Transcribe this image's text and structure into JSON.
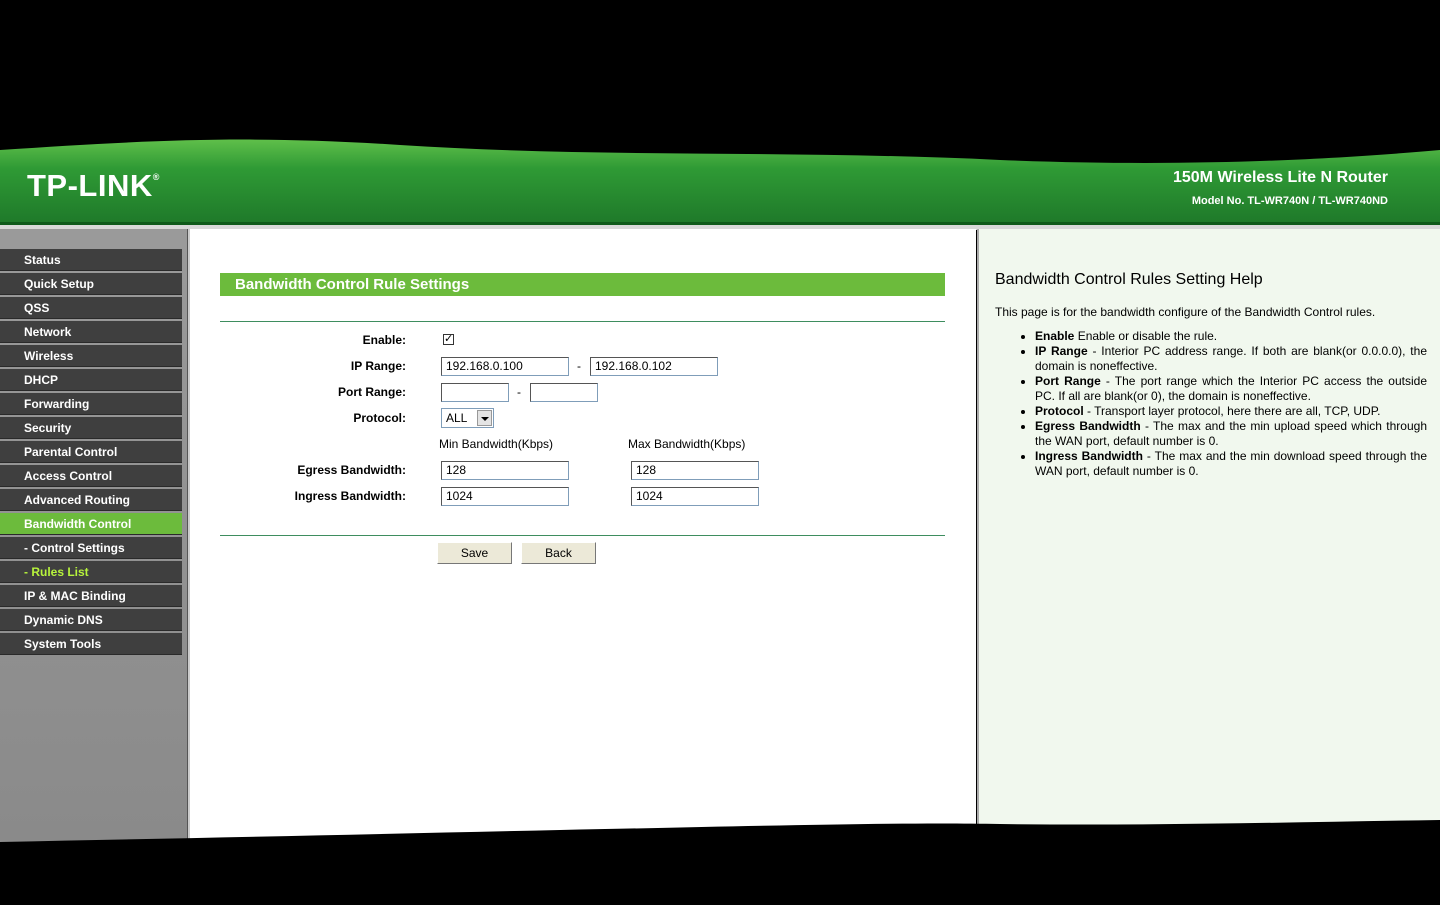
{
  "brand": {
    "logo": "TP-LINK",
    "reg_mark": "®"
  },
  "product": {
    "name": "150M Wireless Lite N Router",
    "model": "Model No. TL-WR740N / TL-WR740ND"
  },
  "sidebar": {
    "items": [
      {
        "label": "Status"
      },
      {
        "label": "Quick Setup"
      },
      {
        "label": "QSS"
      },
      {
        "label": "Network"
      },
      {
        "label": "Wireless"
      },
      {
        "label": "DHCP"
      },
      {
        "label": "Forwarding"
      },
      {
        "label": "Security"
      },
      {
        "label": "Parental Control"
      },
      {
        "label": "Access Control"
      },
      {
        "label": "Advanced Routing"
      },
      {
        "label": "Bandwidth Control"
      },
      {
        "label": "- Control Settings"
      },
      {
        "label": "- Rules List"
      },
      {
        "label": "IP & MAC Binding"
      },
      {
        "label": "Dynamic DNS"
      },
      {
        "label": "System Tools"
      }
    ],
    "active_color": "#6cbb3c"
  },
  "form": {
    "title": "Bandwidth Control Rule Settings",
    "enable_label": "Enable:",
    "enable_checked": "✓",
    "ip_range_label": "IP Range:",
    "ip_start": "192.168.0.100",
    "ip_end": "192.168.0.102",
    "port_range_label": "Port Range:",
    "port_start": "",
    "port_end": "",
    "range_sep": "-",
    "protocol_label": "Protocol:",
    "protocol_value": "ALL",
    "min_bw_header": "Min Bandwidth(Kbps)",
    "max_bw_header": "Max Bandwidth(Kbps)",
    "egress_label": "Egress Bandwidth:",
    "egress_min": "128",
    "egress_max": "128",
    "ingress_label": "Ingress Bandwidth:",
    "ingress_min": "1024",
    "ingress_max": "1024",
    "save_label": "Save",
    "back_label": "Back"
  },
  "help": {
    "title": "Bandwidth Control Rules Setting Help",
    "intro": "This page is for the bandwidth configure of the Bandwidth Control rules.",
    "items": [
      {
        "term": "Enable",
        "text": " Enable or disable the rule."
      },
      {
        "term": "IP Range",
        "text": " - Interior PC address range. If both are blank(or 0.0.0.0), the domain is noneffective."
      },
      {
        "term": "Port Range",
        "text": " - The port range which the Interior PC access the outside PC. If all are blank(or 0), the domain is noneffective."
      },
      {
        "term": "Protocol",
        "text": " - Transport layer protocol, here there are all, TCP, UDP."
      },
      {
        "term": "Egress Bandwidth",
        "text": " - The max and the min upload speed which through the WAN port, default number is 0."
      },
      {
        "term": "Ingress Bandwidth",
        "text": " - The max and the min download speed through the WAN port, default number is 0."
      }
    ]
  },
  "colors": {
    "header_green": "#2f8a2a",
    "accent_green": "#6cbb3c",
    "sidebar_item": "#3f3f3f",
    "help_bg": "#f1f8ee"
  }
}
